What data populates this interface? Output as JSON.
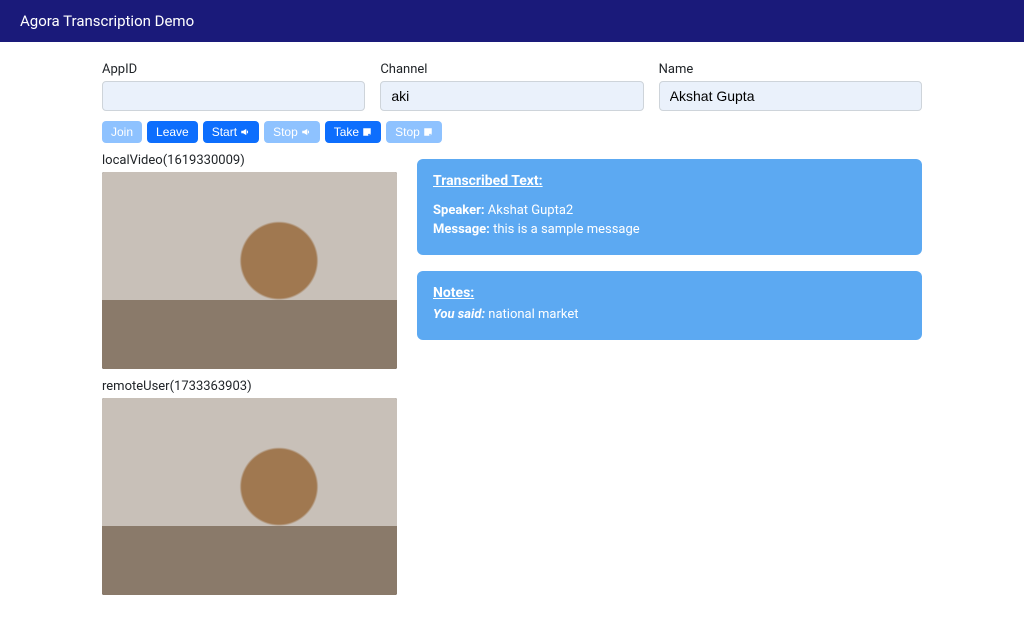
{
  "navbar": {
    "title": "Agora Transcription Demo"
  },
  "form": {
    "appid": {
      "label": "AppID",
      "value": ""
    },
    "channel": {
      "label": "Channel",
      "value": "aki"
    },
    "name": {
      "label": "Name",
      "value": "Akshat Gupta"
    }
  },
  "buttons": {
    "join": "Join",
    "leave": "Leave",
    "start": "Start",
    "stop": "Stop",
    "take": "Take",
    "stop2": "Stop"
  },
  "videos": {
    "local": {
      "label": "localVideo(1619330009)"
    },
    "remote": {
      "label": "remoteUser(1733363903)"
    }
  },
  "transcription": {
    "title": "Transcribed Text:",
    "speaker_label": "Speaker:",
    "speaker": "Akshat Gupta2",
    "message_label": "Message:",
    "message": "this is a sample message"
  },
  "notes": {
    "title": "Notes:",
    "prefix": "You said:",
    "text": "national market"
  }
}
